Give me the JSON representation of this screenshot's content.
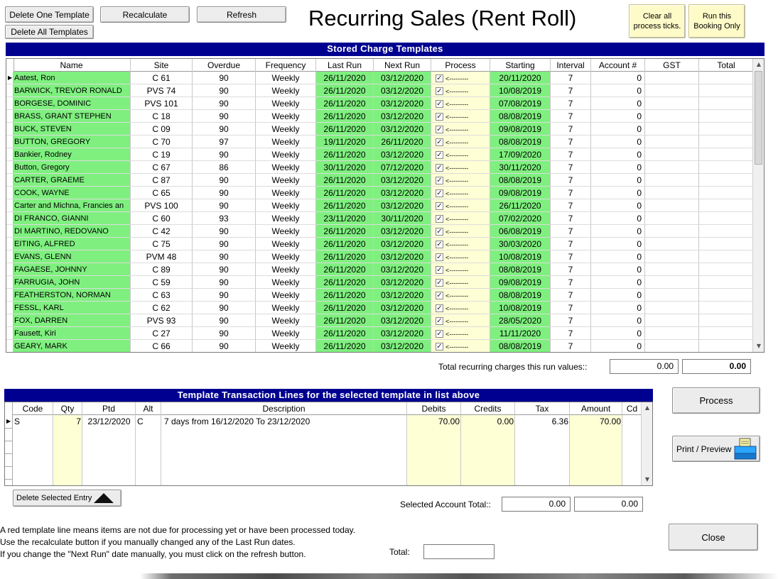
{
  "window": {
    "title": "Recurring Sales (Rent Roll)"
  },
  "toolbar": {
    "delete_one": "Delete One Template",
    "recalculate": "Recalculate",
    "refresh": "Refresh",
    "delete_all": "Delete All Templates",
    "clear_ticks": "Clear all\nprocess ticks.",
    "run_booking": "Run this\nBooking Only"
  },
  "templates": {
    "title": "Stored Charge Templates",
    "columns": [
      "Name",
      "Site",
      "Overdue",
      "Frequency",
      "Last Run",
      "Next Run",
      "Process",
      "Starting",
      "Interval",
      "Account #",
      "GST",
      "Total"
    ],
    "process_marker": "<---------",
    "rows": [
      [
        "Aatest, Ron",
        "C   61",
        "90",
        "Weekly",
        "26/11/2020",
        "03/12/2020",
        "20/11/2020",
        "7",
        "0"
      ],
      [
        "BARWICK, TREVOR RONALD",
        "PVS  74",
        "90",
        "Weekly",
        "26/11/2020",
        "03/12/2020",
        "10/08/2019",
        "7",
        "0"
      ],
      [
        "BORGESE, DOMINIC",
        "PVS 101",
        "90",
        "Weekly",
        "26/11/2020",
        "03/12/2020",
        "07/08/2019",
        "7",
        "0"
      ],
      [
        "BRASS, GRANT STEPHEN",
        "C   18",
        "90",
        "Weekly",
        "26/11/2020",
        "03/12/2020",
        "08/08/2019",
        "7",
        "0"
      ],
      [
        "BUCK, STEVEN",
        "C   09",
        "90",
        "Weekly",
        "26/11/2020",
        "03/12/2020",
        "09/08/2019",
        "7",
        "0"
      ],
      [
        "BUTTON, GREGORY",
        "C   70",
        "97",
        "Weekly",
        "19/11/2020",
        "26/11/2020",
        "08/08/2019",
        "7",
        "0"
      ],
      [
        "Bankier, Rodney",
        "C   19",
        "90",
        "Weekly",
        "26/11/2020",
        "03/12/2020",
        "17/09/2020",
        "7",
        "0"
      ],
      [
        "Button, Gregory",
        "C   67",
        "86",
        "Weekly",
        "30/11/2020",
        "07/12/2020",
        "30/11/2020",
        "7",
        "0"
      ],
      [
        "CARTER, GRAEME",
        "C   87",
        "90",
        "Weekly",
        "26/11/2020",
        "03/12/2020",
        "08/08/2019",
        "7",
        "0"
      ],
      [
        "COOK, WAYNE",
        "C   65",
        "90",
        "Weekly",
        "26/11/2020",
        "03/12/2020",
        "09/08/2019",
        "7",
        "0"
      ],
      [
        "Carter and Michna, Francies an",
        "PVS 100",
        "90",
        "Weekly",
        "26/11/2020",
        "03/12/2020",
        "26/11/2020",
        "7",
        "0"
      ],
      [
        "DI FRANCO, GIANNI",
        "C   60",
        "93",
        "Weekly",
        "23/11/2020",
        "30/11/2020",
        "07/02/2020",
        "7",
        "0"
      ],
      [
        "DI MARTINO, REDOVANO",
        "C   42",
        "90",
        "Weekly",
        "26/11/2020",
        "03/12/2020",
        "06/08/2019",
        "7",
        "0"
      ],
      [
        "EITING, ALFRED",
        "C   75",
        "90",
        "Weekly",
        "26/11/2020",
        "03/12/2020",
        "30/03/2020",
        "7",
        "0"
      ],
      [
        "EVANS, GLENN",
        "PVM  48",
        "90",
        "Weekly",
        "26/11/2020",
        "03/12/2020",
        "10/08/2019",
        "7",
        "0"
      ],
      [
        "FAGAESE, JOHNNY",
        "C   89",
        "90",
        "Weekly",
        "26/11/2020",
        "03/12/2020",
        "08/08/2019",
        "7",
        "0"
      ],
      [
        "FARRUGIA, JOHN",
        "C   59",
        "90",
        "Weekly",
        "26/11/2020",
        "03/12/2020",
        "09/08/2019",
        "7",
        "0"
      ],
      [
        "FEATHERSTON, NORMAN",
        "C   63",
        "90",
        "Weekly",
        "26/11/2020",
        "03/12/2020",
        "08/08/2019",
        "7",
        "0"
      ],
      [
        "FESSL, KARL",
        "C   62",
        "90",
        "Weekly",
        "26/11/2020",
        "03/12/2020",
        "10/08/2019",
        "7",
        "0"
      ],
      [
        "FOX, DARREN",
        "PVS  93",
        "90",
        "Weekly",
        "26/11/2020",
        "03/12/2020",
        "28/05/2020",
        "7",
        "0"
      ],
      [
        "Fausett, Kiri",
        "C   27",
        "90",
        "Weekly",
        "26/11/2020",
        "03/12/2020",
        "11/11/2020",
        "7",
        "0"
      ],
      [
        "GEARY, MARK",
        "C   66",
        "90",
        "Weekly",
        "26/11/2020",
        "03/12/2020",
        "08/08/2019",
        "7",
        "0"
      ]
    ]
  },
  "totals": {
    "label": "Total recurring charges this  run values::",
    "value1": "0.00",
    "value2": "0.00"
  },
  "lines": {
    "title": "Template Transaction Lines for the selected template in list above",
    "columns": [
      "Code",
      "Qty",
      "Ptd",
      "Alt",
      "Description",
      "Debits",
      "Credits",
      "Tax",
      "Amount",
      "Cd"
    ],
    "rows": [
      [
        "S",
        "7",
        "23/12/2020",
        "C",
        "7 days from 16/12/2020 To 23/12/2020",
        "70.00",
        "0.00",
        "6.36",
        "70.00",
        ""
      ]
    ]
  },
  "actions": {
    "process": "Process",
    "print_preview": "Print / Preview",
    "delete_entry": "Delete Selected Entry",
    "close": "Close"
  },
  "account": {
    "label": "Selected Account Total::",
    "value1": "0.00",
    "value2": "0.00",
    "total_label": "Total:",
    "total_value": ""
  },
  "notes": [
    "A red template line means items are not due  for processing yet or have been processed today.",
    "Use the recalculate button if you manually changed any of the Last Run dates.",
    "If you change the \"Next Run\" date manually, you must click on the refresh button."
  ],
  "colors": {
    "header_bar": "#000090",
    "due_green": "#7ff07f",
    "pale_yellow": "#ffffd6"
  }
}
